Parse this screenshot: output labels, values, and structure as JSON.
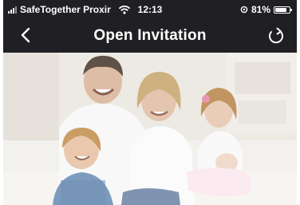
{
  "status_bar": {
    "carrier": "SafeTogether Proxir",
    "time": "12:13",
    "battery": "81%",
    "battery_level": 0.81
  },
  "nav": {
    "title": "Open Invitation",
    "back_icon": "chevron-left-icon",
    "refresh_icon": "refresh-icon"
  },
  "hero": {
    "image": "family-photo"
  }
}
